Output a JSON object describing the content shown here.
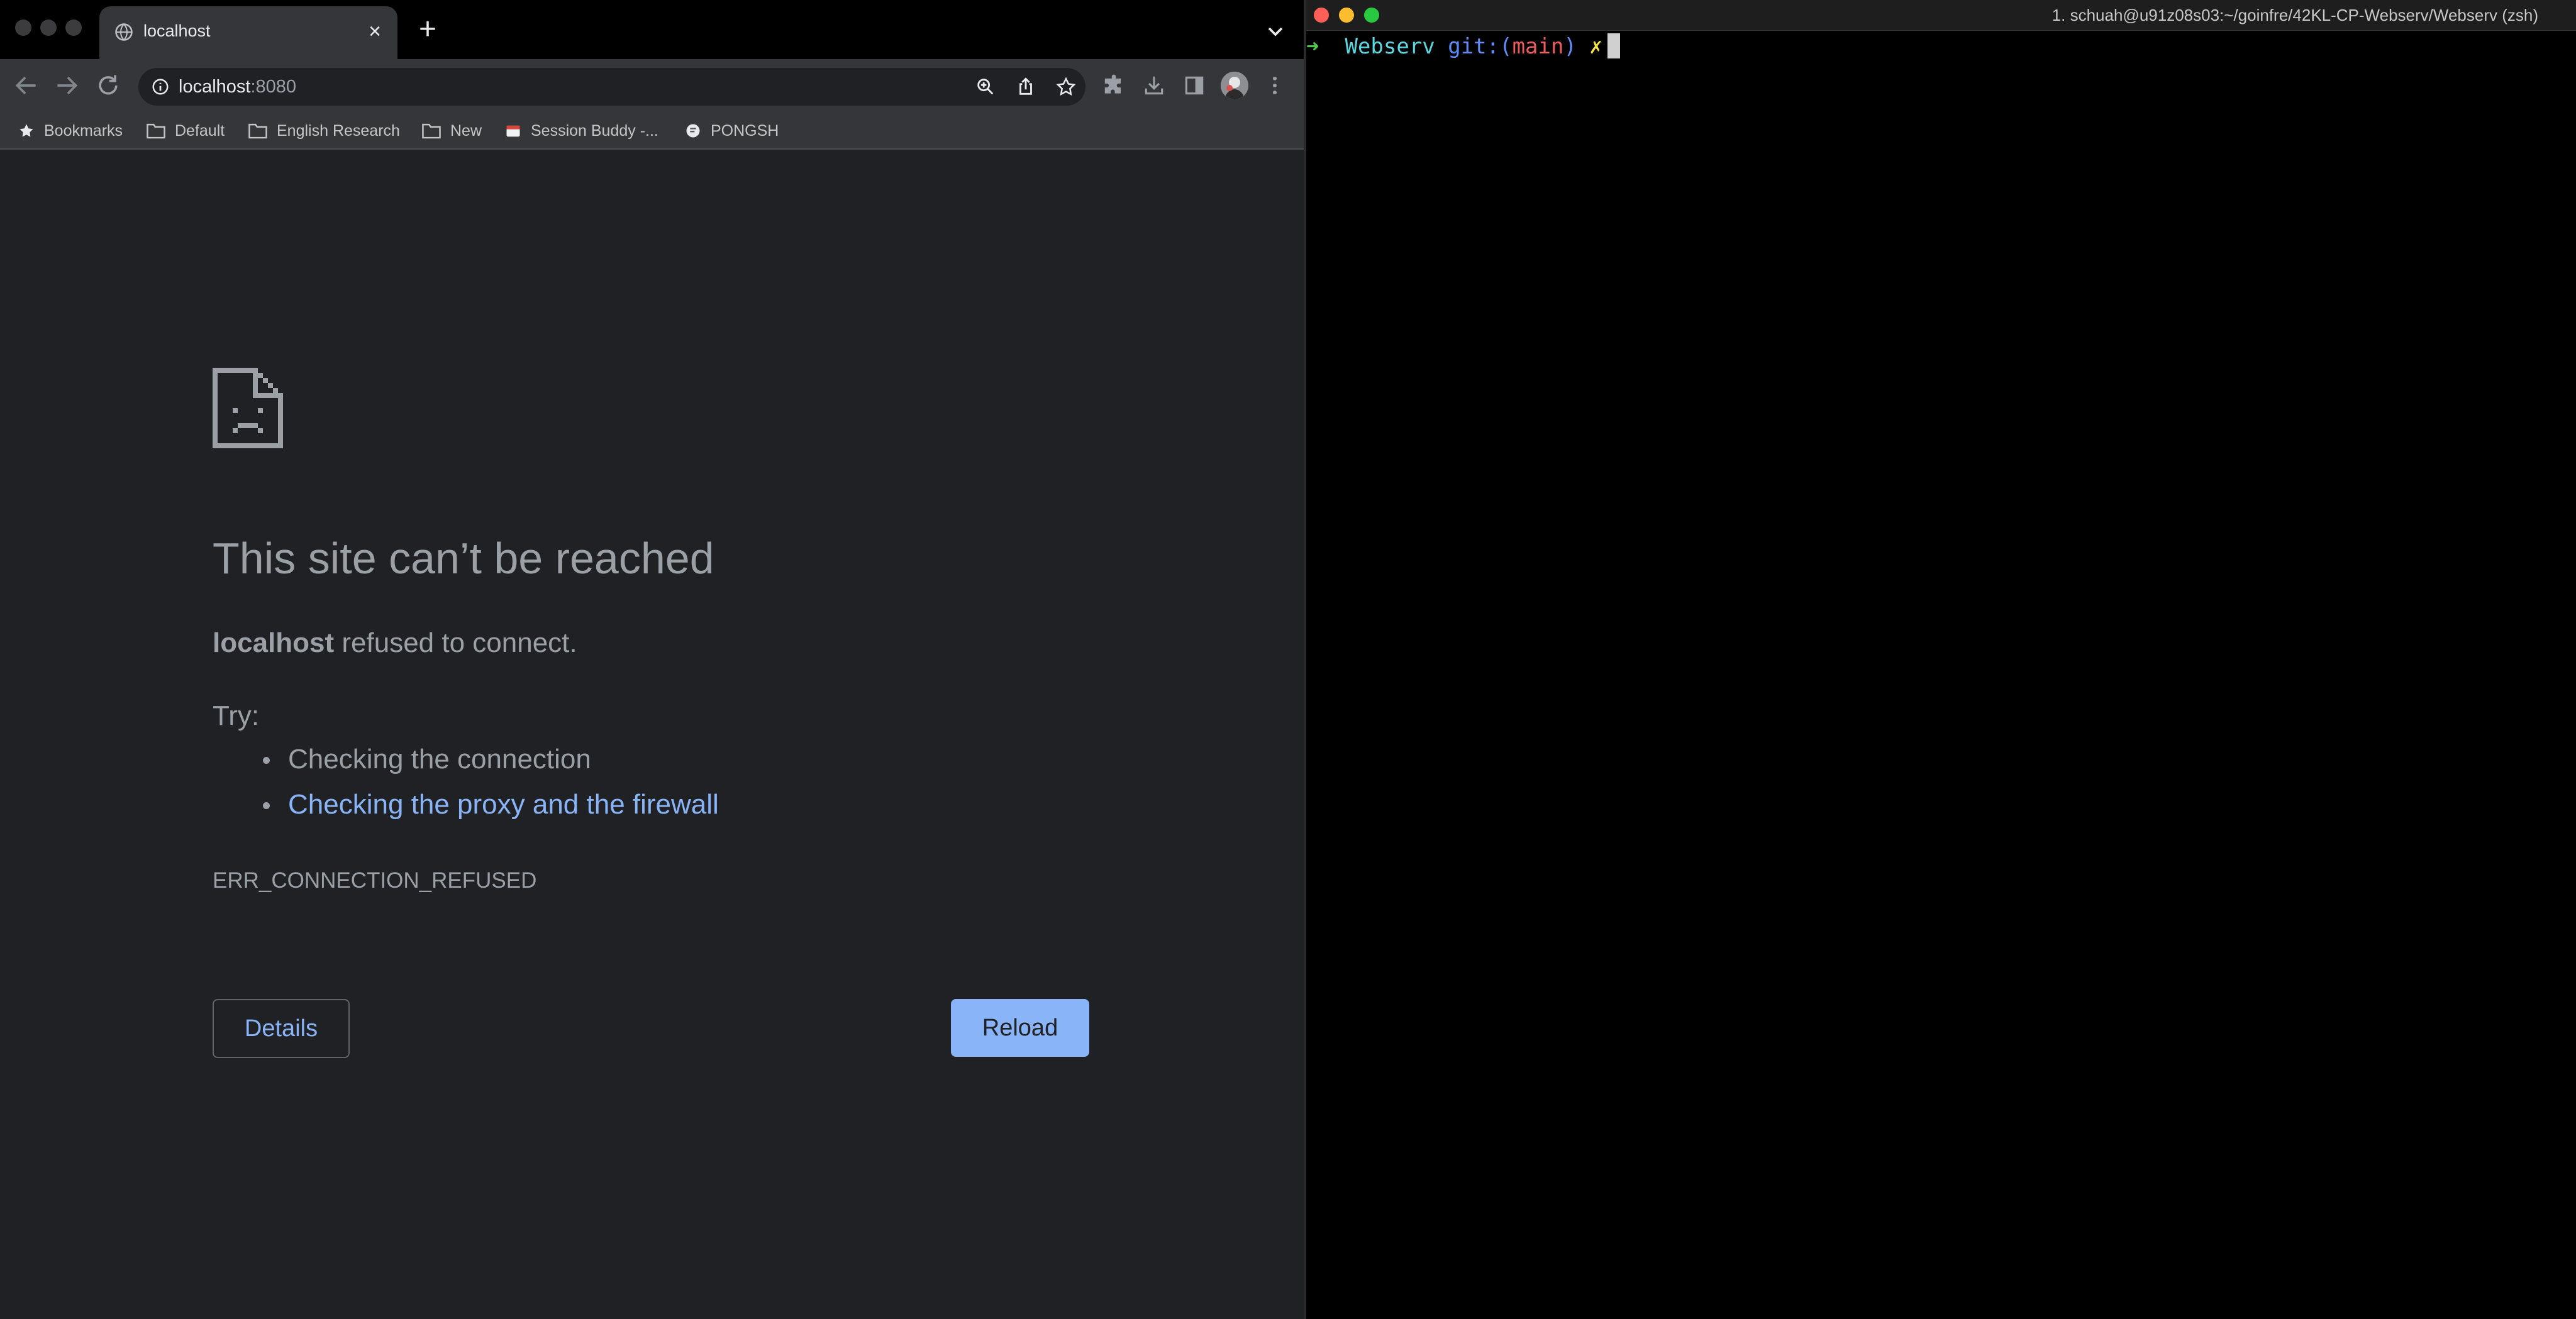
{
  "browser": {
    "tab": {
      "title": "localhost",
      "favicon": "globe-icon"
    },
    "omnibox": {
      "host": "localhost",
      "port": ":8080"
    },
    "bookmarks": [
      {
        "label": "Bookmarks",
        "icon": "star-icon"
      },
      {
        "label": "Default",
        "icon": "folder-icon"
      },
      {
        "label": "English Research",
        "icon": "folder-icon"
      },
      {
        "label": "New",
        "icon": "folder-icon"
      },
      {
        "label": "Session Buddy -...",
        "icon": "session-buddy-icon"
      },
      {
        "label": "PONGSH",
        "icon": "pongsh-icon"
      }
    ],
    "error": {
      "title": "This site can’t be reached",
      "host": "localhost",
      "message": " refused to connect.",
      "try_label": "Try:",
      "suggestions": [
        {
          "text": "Checking the connection",
          "is_link": false
        },
        {
          "text": "Checking the proxy and the firewall",
          "is_link": true
        }
      ],
      "code": "ERR_CONNECTION_REFUSED",
      "details_button": "Details",
      "reload_button": "Reload"
    },
    "colors": {
      "link": "#8ab4f8",
      "primary_button": "#8ab4f8",
      "background": "#202124"
    }
  },
  "terminal": {
    "title": "1. schuah@u91z08s03:~/goinfre/42KL-CP-Webserv/Webserv (zsh)",
    "prompt": {
      "arrow": "➜",
      "dir": "Webserv",
      "git_label": "git:(",
      "branch": "main",
      "git_close": ")",
      "dirty": "✗"
    }
  }
}
